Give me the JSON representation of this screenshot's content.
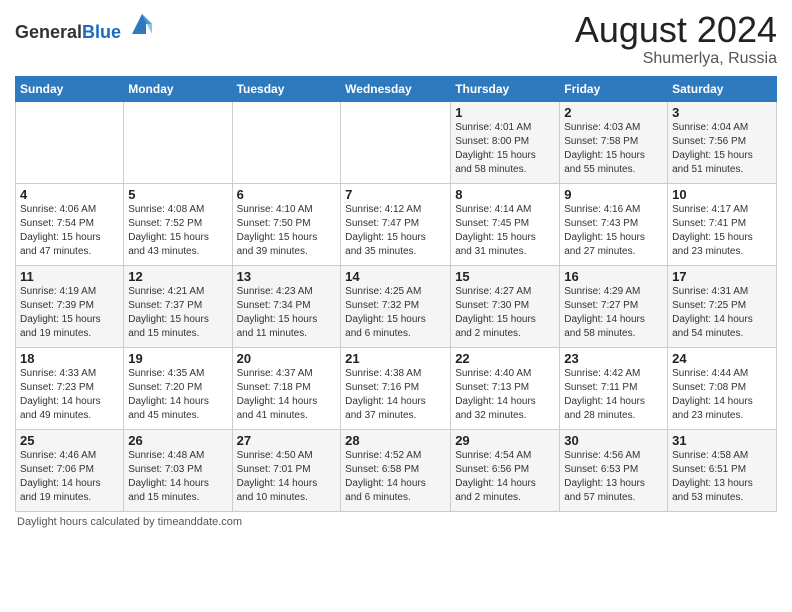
{
  "header": {
    "logo_line1": "General",
    "logo_line2": "Blue",
    "month_year": "August 2024",
    "location": "Shumerlya, Russia"
  },
  "days_of_week": [
    "Sunday",
    "Monday",
    "Tuesday",
    "Wednesday",
    "Thursday",
    "Friday",
    "Saturday"
  ],
  "weeks": [
    [
      {
        "day": "",
        "info": ""
      },
      {
        "day": "",
        "info": ""
      },
      {
        "day": "",
        "info": ""
      },
      {
        "day": "",
        "info": ""
      },
      {
        "day": "1",
        "info": "Sunrise: 4:01 AM\nSunset: 8:00 PM\nDaylight: 15 hours\nand 58 minutes."
      },
      {
        "day": "2",
        "info": "Sunrise: 4:03 AM\nSunset: 7:58 PM\nDaylight: 15 hours\nand 55 minutes."
      },
      {
        "day": "3",
        "info": "Sunrise: 4:04 AM\nSunset: 7:56 PM\nDaylight: 15 hours\nand 51 minutes."
      }
    ],
    [
      {
        "day": "4",
        "info": "Sunrise: 4:06 AM\nSunset: 7:54 PM\nDaylight: 15 hours\nand 47 minutes."
      },
      {
        "day": "5",
        "info": "Sunrise: 4:08 AM\nSunset: 7:52 PM\nDaylight: 15 hours\nand 43 minutes."
      },
      {
        "day": "6",
        "info": "Sunrise: 4:10 AM\nSunset: 7:50 PM\nDaylight: 15 hours\nand 39 minutes."
      },
      {
        "day": "7",
        "info": "Sunrise: 4:12 AM\nSunset: 7:47 PM\nDaylight: 15 hours\nand 35 minutes."
      },
      {
        "day": "8",
        "info": "Sunrise: 4:14 AM\nSunset: 7:45 PM\nDaylight: 15 hours\nand 31 minutes."
      },
      {
        "day": "9",
        "info": "Sunrise: 4:16 AM\nSunset: 7:43 PM\nDaylight: 15 hours\nand 27 minutes."
      },
      {
        "day": "10",
        "info": "Sunrise: 4:17 AM\nSunset: 7:41 PM\nDaylight: 15 hours\nand 23 minutes."
      }
    ],
    [
      {
        "day": "11",
        "info": "Sunrise: 4:19 AM\nSunset: 7:39 PM\nDaylight: 15 hours\nand 19 minutes."
      },
      {
        "day": "12",
        "info": "Sunrise: 4:21 AM\nSunset: 7:37 PM\nDaylight: 15 hours\nand 15 minutes."
      },
      {
        "day": "13",
        "info": "Sunrise: 4:23 AM\nSunset: 7:34 PM\nDaylight: 15 hours\nand 11 minutes."
      },
      {
        "day": "14",
        "info": "Sunrise: 4:25 AM\nSunset: 7:32 PM\nDaylight: 15 hours\nand 6 minutes."
      },
      {
        "day": "15",
        "info": "Sunrise: 4:27 AM\nSunset: 7:30 PM\nDaylight: 15 hours\nand 2 minutes."
      },
      {
        "day": "16",
        "info": "Sunrise: 4:29 AM\nSunset: 7:27 PM\nDaylight: 14 hours\nand 58 minutes."
      },
      {
        "day": "17",
        "info": "Sunrise: 4:31 AM\nSunset: 7:25 PM\nDaylight: 14 hours\nand 54 minutes."
      }
    ],
    [
      {
        "day": "18",
        "info": "Sunrise: 4:33 AM\nSunset: 7:23 PM\nDaylight: 14 hours\nand 49 minutes."
      },
      {
        "day": "19",
        "info": "Sunrise: 4:35 AM\nSunset: 7:20 PM\nDaylight: 14 hours\nand 45 minutes."
      },
      {
        "day": "20",
        "info": "Sunrise: 4:37 AM\nSunset: 7:18 PM\nDaylight: 14 hours\nand 41 minutes."
      },
      {
        "day": "21",
        "info": "Sunrise: 4:38 AM\nSunset: 7:16 PM\nDaylight: 14 hours\nand 37 minutes."
      },
      {
        "day": "22",
        "info": "Sunrise: 4:40 AM\nSunset: 7:13 PM\nDaylight: 14 hours\nand 32 minutes."
      },
      {
        "day": "23",
        "info": "Sunrise: 4:42 AM\nSunset: 7:11 PM\nDaylight: 14 hours\nand 28 minutes."
      },
      {
        "day": "24",
        "info": "Sunrise: 4:44 AM\nSunset: 7:08 PM\nDaylight: 14 hours\nand 23 minutes."
      }
    ],
    [
      {
        "day": "25",
        "info": "Sunrise: 4:46 AM\nSunset: 7:06 PM\nDaylight: 14 hours\nand 19 minutes."
      },
      {
        "day": "26",
        "info": "Sunrise: 4:48 AM\nSunset: 7:03 PM\nDaylight: 14 hours\nand 15 minutes."
      },
      {
        "day": "27",
        "info": "Sunrise: 4:50 AM\nSunset: 7:01 PM\nDaylight: 14 hours\nand 10 minutes."
      },
      {
        "day": "28",
        "info": "Sunrise: 4:52 AM\nSunset: 6:58 PM\nDaylight: 14 hours\nand 6 minutes."
      },
      {
        "day": "29",
        "info": "Sunrise: 4:54 AM\nSunset: 6:56 PM\nDaylight: 14 hours\nand 2 minutes."
      },
      {
        "day": "30",
        "info": "Sunrise: 4:56 AM\nSunset: 6:53 PM\nDaylight: 13 hours\nand 57 minutes."
      },
      {
        "day": "31",
        "info": "Sunrise: 4:58 AM\nSunset: 6:51 PM\nDaylight: 13 hours\nand 53 minutes."
      }
    ]
  ],
  "footer": {
    "daylight_label": "Daylight hours"
  }
}
